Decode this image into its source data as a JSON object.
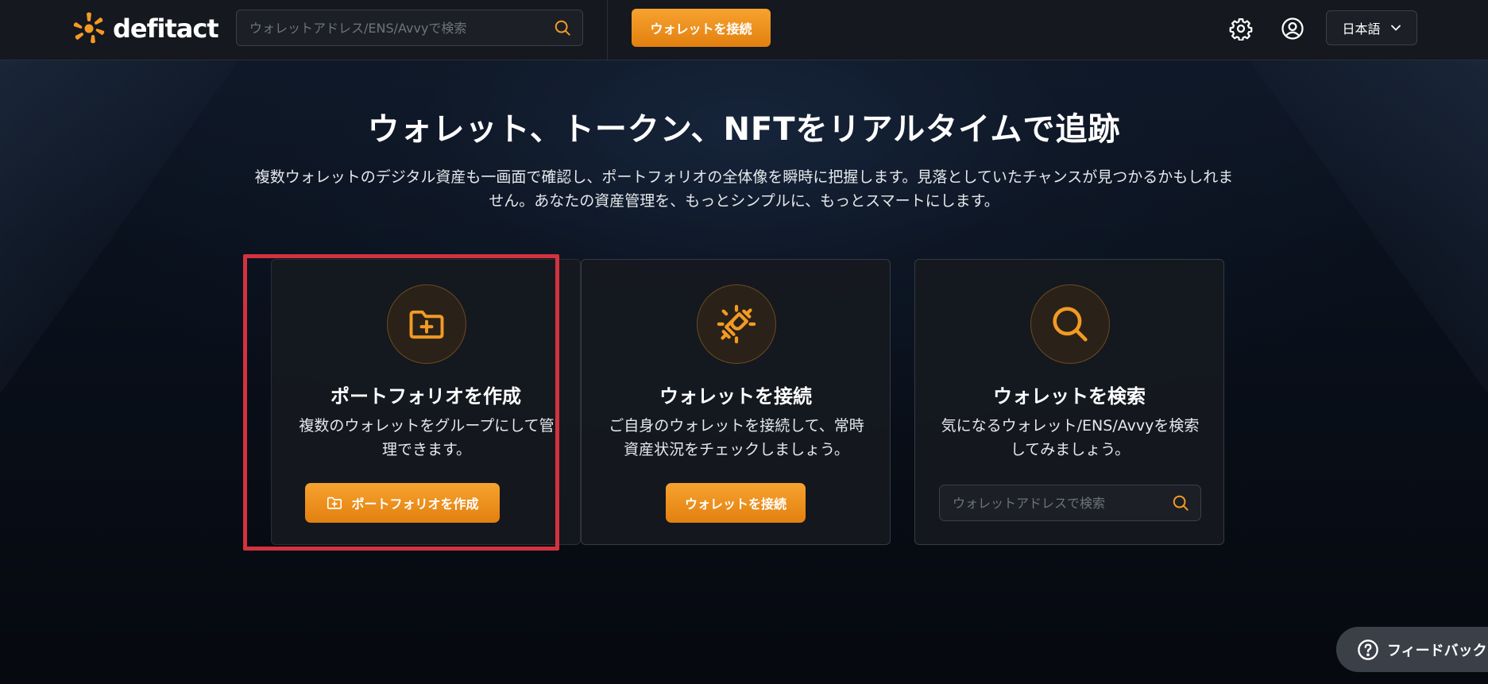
{
  "header": {
    "brand": "defitact",
    "search_placeholder": "ウォレットアドレス/ENS/Avvyで検索",
    "connect_label": "ウォレットを接続",
    "language": "日本語",
    "icons": [
      "settings-gear-icon",
      "user-icon",
      "chevron-down-icon",
      "search-icon"
    ]
  },
  "hero": {
    "title": "ウォレット、トークン、NFTをリアルタイムで追跡",
    "subtitle": "複数ウォレットのデジタル資産も一画面で確認し、ポートフォリオの全体像を瞬時に把握します。見落としていたチャンスが見つかるかもしれません。あなたの資産管理を、もっとシンプルに、もっとスマートにします。"
  },
  "cards": [
    {
      "icon": "folder-plus-icon",
      "title": "ポートフォリオを作成",
      "description": "複数のウォレットをグループにして管理できます。",
      "button": "ポートフォリオを作成",
      "highlighted": true
    },
    {
      "icon": "plug-connect-icon",
      "title": "ウォレットを接続",
      "description": "ご自身のウォレットを接続して、常時資産状況をチェックしましょう。",
      "button": "ウォレットを接続"
    },
    {
      "icon": "magnifier-icon",
      "title": "ウォレットを検索",
      "description": "気になるウォレット/ENS/Avvyを検索してみましょう。",
      "search_placeholder": "ウォレットアドレスで検索"
    }
  ],
  "feedback": {
    "label": "フィードバック",
    "icon": "question-circle-icon"
  },
  "colors": {
    "accent": "#F39A25",
    "highlight_border": "#D4323F",
    "background": "#070B14"
  }
}
